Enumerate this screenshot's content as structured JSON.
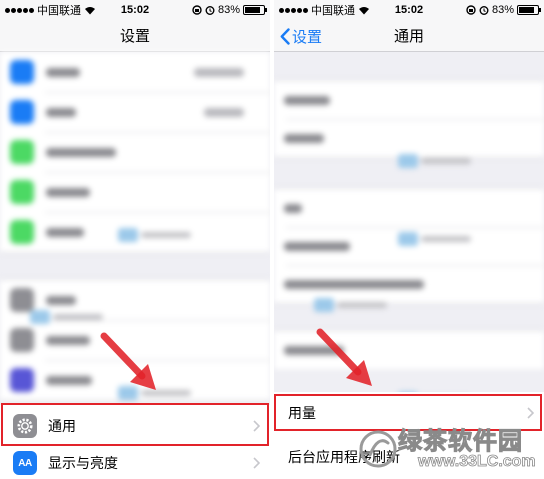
{
  "status_bar": {
    "carrier": "中国联通",
    "time": "15:02",
    "battery_percent": "83%",
    "battery_level": 0.83
  },
  "left_screen": {
    "nav_title": "设置",
    "visible_rows": [
      {
        "label": "通用",
        "icon": "gear-icon",
        "highlighted": true
      },
      {
        "label": "显示与亮度",
        "icon": "aa-icon",
        "icon_text": "AA"
      }
    ],
    "blurred_icon_colors": [
      "#1a7cf5",
      "#1a7cf5",
      "#4cd964",
      "#4cd964",
      "#4cd964",
      "#8e8e93",
      "#8e8e93",
      "#5856d6"
    ]
  },
  "right_screen": {
    "back_label": "设置",
    "nav_title": "通用",
    "visible_rows": [
      {
        "label": "用量",
        "highlighted": true
      },
      {
        "label": "后台应用程序刷新"
      }
    ]
  },
  "colors": {
    "highlight": "#e2232a",
    "ios_blue": "#1a7cf5",
    "background": "#efeff4"
  },
  "watermark": {
    "brand": "绿茶软件园",
    "url": "www.33LC.com"
  }
}
